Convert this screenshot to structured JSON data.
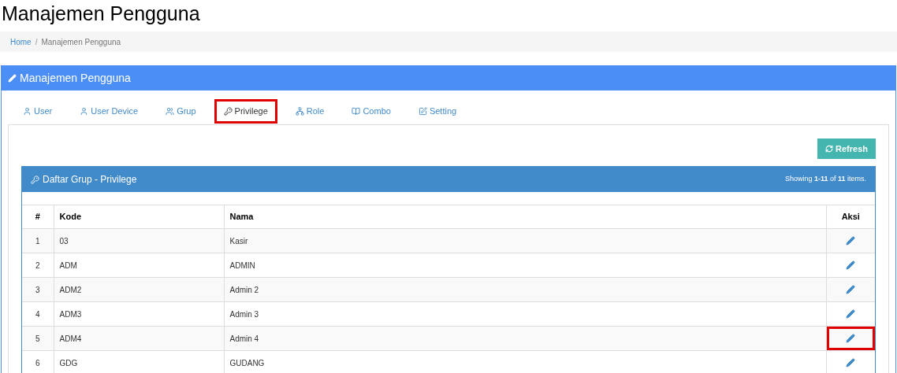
{
  "page_title": "Manajemen Pengguna",
  "breadcrumb": [
    {
      "label": "Home",
      "kind": "link"
    },
    {
      "label": "/",
      "kind": "separator"
    },
    {
      "label": "Manajemen Pengguna",
      "kind": "current"
    }
  ],
  "panel": {
    "title": "Manajemen Pengguna"
  },
  "tabs": [
    {
      "label": "User",
      "selected": false,
      "highlighted": false
    },
    {
      "label": "User Device",
      "selected": false,
      "highlighted": false
    },
    {
      "label": "Grup",
      "selected": false,
      "highlighted": false
    },
    {
      "label": "Privilege",
      "selected": true,
      "highlighted": true
    },
    {
      "label": "Role",
      "selected": false,
      "highlighted": false
    },
    {
      "label": "Combo",
      "selected": false,
      "highlighted": false
    },
    {
      "label": "Setting",
      "selected": false,
      "highlighted": false
    }
  ],
  "refresh_button": "Refresh",
  "list": {
    "title": "Daftar Grup - Privilege",
    "summary": "Showing **1-11** of **11** items."
  },
  "table": {
    "columns": [
      "#",
      "Kode",
      "Nama",
      "Aksi"
    ],
    "rows": [
      {
        "no": "1",
        "kode": "03",
        "nama": "Kasir",
        "highlighted": false
      },
      {
        "no": "2",
        "kode": "ADM",
        "nama": "ADMIN",
        "highlighted": false
      },
      {
        "no": "3",
        "kode": "ADM2",
        "nama": "Admin 2",
        "highlighted": false
      },
      {
        "no": "4",
        "kode": "ADM3",
        "nama": "Admin 3",
        "highlighted": false
      },
      {
        "no": "5",
        "kode": "ADM4",
        "nama": "Admin 4",
        "highlighted": true
      },
      {
        "no": "6",
        "kode": "GDG",
        "nama": "GUDANG",
        "highlighted": false
      }
    ]
  }
}
